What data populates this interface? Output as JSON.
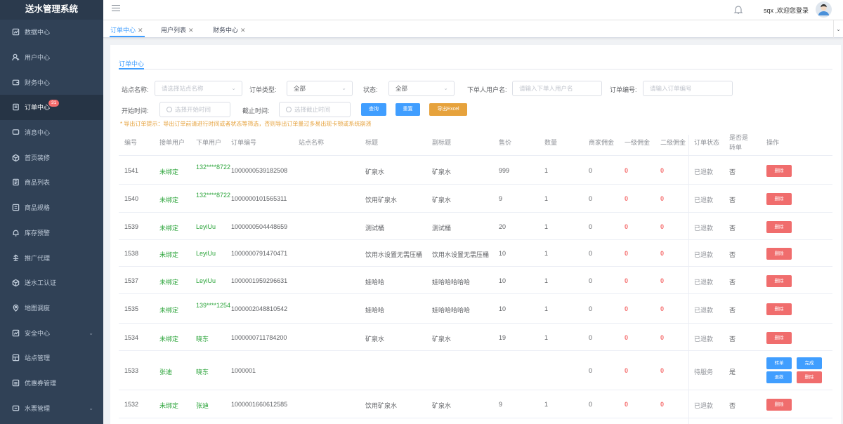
{
  "app": {
    "title": "送水管理系统"
  },
  "sidebar": {
    "items": [
      {
        "label": "数据中心",
        "icon": "dashboard-icon"
      },
      {
        "label": "用户中心",
        "icon": "user-icon"
      },
      {
        "label": "财务中心",
        "icon": "wallet-icon"
      },
      {
        "label": "订单中心",
        "icon": "order-icon",
        "badge": "31",
        "active": true
      },
      {
        "label": "消息中心",
        "icon": "message-icon"
      },
      {
        "label": "首页装修",
        "icon": "cube-icon"
      },
      {
        "label": "商品列表",
        "icon": "list-icon"
      },
      {
        "label": "商品规格",
        "icon": "spec-icon"
      },
      {
        "label": "库存预警",
        "icon": "bell-icon"
      },
      {
        "label": "推广代理",
        "icon": "share-icon"
      },
      {
        "label": "送水工认证",
        "icon": "cube-icon"
      },
      {
        "label": "地图调度",
        "icon": "location-icon"
      },
      {
        "label": "安全中心",
        "icon": "shield-icon",
        "chevron": true
      },
      {
        "label": "站点管理",
        "icon": "site-icon"
      },
      {
        "label": "优惠券管理",
        "icon": "coupon-icon"
      },
      {
        "label": "水票管理",
        "icon": "ticket-icon",
        "chevron": true
      }
    ]
  },
  "header": {
    "welcome": "sqx ,欢迎您登录"
  },
  "tabs": [
    {
      "label": "订单中心",
      "active": true
    },
    {
      "label": "用户列表"
    },
    {
      "label": "财务中心"
    }
  ],
  "card": {
    "tab": "订单中心"
  },
  "filters": {
    "station_label": "站点名称:",
    "station_placeholder": "请选择站点名称",
    "type_label": "订单类型:",
    "type_value": "全部",
    "status_label": "状态:",
    "status_value": "全部",
    "user_label": "下单人用户名:",
    "user_placeholder": "请输入下单人用户名",
    "orderno_label": "订单编号:",
    "orderno_placeholder": "请输入订单编号",
    "start_label": "开始时间:",
    "start_placeholder": "选择开始时间",
    "end_label": "截止时间:",
    "end_placeholder": "选择截止时间",
    "search": "查询",
    "reset": "重置",
    "export": "导出Excel",
    "tip": "* 导出订单提示：导出订单前请进行时间或者状态等筛选，否则导出订单量过多易出现卡顿或系统崩溃"
  },
  "table": {
    "headers": [
      "编号",
      "接单用户",
      "下单用户",
      "订单编号",
      "站点名称",
      "标题",
      "副标题",
      "售价",
      "数量",
      "商家佣金",
      "一级佣金",
      "二级佣金",
      "订单状态",
      "是否是转单",
      "操作"
    ],
    "rows": [
      {
        "id": "1541",
        "receiver": "未绑定",
        "buyer": "132****8722",
        "order_no": "1000000539182508",
        "station": "",
        "title": "矿泉水",
        "subtitle": "矿泉水",
        "price": "999",
        "qty": "1",
        "merchant": "0",
        "lv1": "0",
        "lv2": "0",
        "status": "已退款",
        "transfer": "否",
        "actions": [
          "删除"
        ]
      },
      {
        "id": "1540",
        "receiver": "未绑定",
        "buyer": "132****8722",
        "order_no": "1000000101565311",
        "station": "",
        "title": "饮用矿泉水",
        "subtitle": "矿泉水",
        "price": "9",
        "qty": "1",
        "merchant": "0",
        "lv1": "0",
        "lv2": "0",
        "status": "已退款",
        "transfer": "否",
        "actions": [
          "删除"
        ]
      },
      {
        "id": "1539",
        "receiver": "未绑定",
        "buyer": "LeyiUu",
        "order_no": "1000000504448659",
        "station": "",
        "title": "测试桶",
        "subtitle": "测试桶",
        "price": "20",
        "qty": "1",
        "merchant": "0",
        "lv1": "0",
        "lv2": "0",
        "status": "已退款",
        "transfer": "否",
        "actions": [
          "删除"
        ]
      },
      {
        "id": "1538",
        "receiver": "未绑定",
        "buyer": "LeyiUu",
        "order_no": "1000000791470471",
        "station": "",
        "title": "饮用水设置无需压桶",
        "subtitle": "饮用水设置无需压桶",
        "price": "10",
        "qty": "1",
        "merchant": "0",
        "lv1": "0",
        "lv2": "0",
        "status": "已退款",
        "transfer": "否",
        "actions": [
          "删除"
        ]
      },
      {
        "id": "1537",
        "receiver": "未绑定",
        "buyer": "LeyiUu",
        "order_no": "1000001959296631",
        "station": "",
        "title": "娃哈哈",
        "subtitle": "娃哈哈哈哈哈",
        "price": "10",
        "qty": "1",
        "merchant": "0",
        "lv1": "0",
        "lv2": "0",
        "status": "已退款",
        "transfer": "否",
        "actions": [
          "删除"
        ]
      },
      {
        "id": "1535",
        "receiver": "未绑定",
        "buyer": "139****1254",
        "order_no": "1000002048810542",
        "station": "",
        "title": "娃哈哈",
        "subtitle": "娃哈哈哈哈哈",
        "price": "10",
        "qty": "1",
        "merchant": "0",
        "lv1": "0",
        "lv2": "0",
        "status": "已退款",
        "transfer": "否",
        "actions": [
          "删除"
        ]
      },
      {
        "id": "1534",
        "receiver": "未绑定",
        "buyer": "晓东",
        "order_no": "1000000711784200",
        "station": "",
        "title": "矿泉水",
        "subtitle": "矿泉水",
        "price": "19",
        "qty": "1",
        "merchant": "0",
        "lv1": "0",
        "lv2": "0",
        "status": "已退款",
        "transfer": "否",
        "actions": [
          "删除"
        ]
      },
      {
        "id": "1533",
        "receiver": "张迪",
        "buyer": "晓东",
        "order_no": "1000001",
        "station": "",
        "title": "",
        "subtitle": "",
        "price": "",
        "qty": "",
        "merchant": "0",
        "lv1": "0",
        "lv2": "0",
        "status": "待服务",
        "transfer": "是",
        "actions": [
          "转单",
          "完成",
          "退款",
          "删除"
        ]
      },
      {
        "id": "1532",
        "receiver": "未绑定",
        "buyer": "张迪",
        "order_no": "1000001660612585",
        "station": "",
        "title": "饮用矿泉水",
        "subtitle": "矿泉水",
        "price": "9",
        "qty": "1",
        "merchant": "0",
        "lv1": "0",
        "lv2": "0",
        "status": "已退款",
        "transfer": "否",
        "actions": [
          "删除"
        ]
      }
    ]
  },
  "colors": {
    "sidebar": "#304156",
    "accent": "#409eff",
    "danger": "#f06d6d",
    "warning": "#e6a23c",
    "success": "#2da53c"
  }
}
